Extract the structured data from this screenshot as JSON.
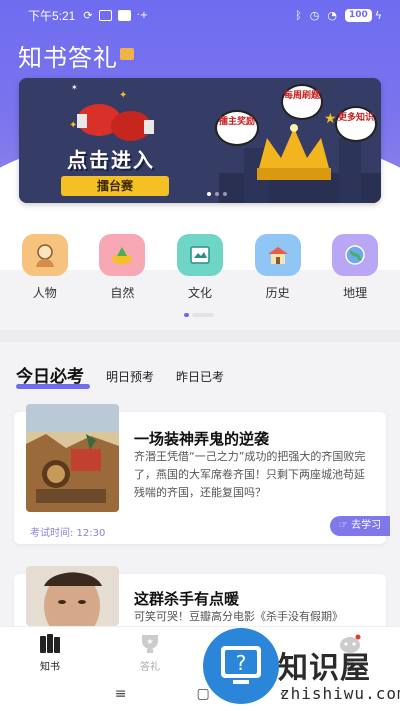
{
  "status_bar": {
    "time": "下午5:21",
    "battery": "100"
  },
  "app": {
    "title": "知书答礼"
  },
  "banner": {
    "headline": "点击进入",
    "button_label": "擂台赛",
    "bubble_1": "每周刷题",
    "bubble_2": "擂主奖励",
    "bubble_3": "更多知识"
  },
  "categories": [
    {
      "label": "人物",
      "icon": "person-icon",
      "color": "#f7c27d"
    },
    {
      "label": "自然",
      "icon": "nature-icon",
      "color": "#f8a7b5"
    },
    {
      "label": "文化",
      "icon": "culture-icon",
      "color": "#6fd6c7"
    },
    {
      "label": "历史",
      "icon": "history-icon",
      "color": "#8fc6f5"
    },
    {
      "label": "地理",
      "icon": "geography-icon",
      "color": "#b9a6f5"
    }
  ],
  "tabs": {
    "active": "今日必考",
    "second": "明日预考",
    "third": "昨日已考"
  },
  "cards": [
    {
      "title": "一场装神弄鬼的逆袭",
      "desc": "齐湣王凭借“一己之力”成功的把强大的齐国败完了，燕国的大军席卷齐国！只剩下两座城池苟延残喘的齐国，还能复国吗？",
      "time": "考试时间: 12:30",
      "button": "去学习"
    },
    {
      "title": "这群杀手有点暖",
      "desc": "可笑可哭！豆瓣高分电影《杀手没有假期》"
    }
  ],
  "bottom_nav": {
    "item1": "知书",
    "item2": "答礼",
    "item4": "我"
  },
  "watermark": {
    "brand": "知识屋",
    "domain": "zhishiwu.com"
  },
  "colors": {
    "accent": "#6f6cf0",
    "banner_yellow": "#f5c024"
  }
}
